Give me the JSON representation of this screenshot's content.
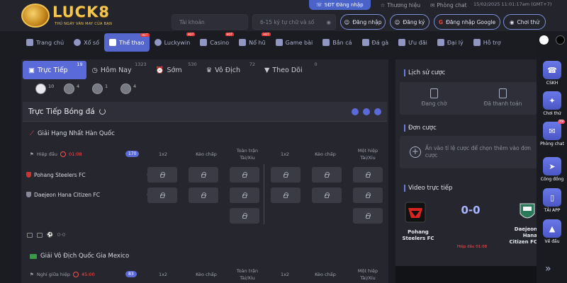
{
  "brand": {
    "name": "LUCK8",
    "tagline": "THỦ NGÀY VÀN MAY CỦA BẠN"
  },
  "topbar": {
    "phone_login": "SĐT Đăng nhập",
    "brand_link": "Thương hiệu",
    "chat_link": "Phòng chat",
    "datetime": "15/02/2025 11:01:17am (GMT+7)"
  },
  "login": {
    "username_placeholder": "Tài khoản",
    "password_placeholder": "6-15 ký tự chữ và số",
    "login_btn": "Đăng nhập",
    "register_btn": "Đăng ký",
    "google_btn": "Đăng nhập Google",
    "demo_btn": "Chơi thử"
  },
  "nav": [
    {
      "label": "Trang chủ",
      "hot": ""
    },
    {
      "label": "Xổ số",
      "hot": ""
    },
    {
      "label": "Thể thao",
      "hot": "HOT"
    },
    {
      "label": "Luckywin",
      "hot": "HOT"
    },
    {
      "label": "Casino",
      "hot": "HOT"
    },
    {
      "label": "Nổ hũ",
      "hot": "HOT"
    },
    {
      "label": "Game bài",
      "hot": ""
    },
    {
      "label": "Bắn cá",
      "hot": ""
    },
    {
      "label": "Đá gà",
      "hot": ""
    },
    {
      "label": "Ưu đãi",
      "hot": ""
    },
    {
      "label": "Đại lý",
      "hot": ""
    },
    {
      "label": "Hỗ trợ",
      "hot": ""
    }
  ],
  "tabs": [
    {
      "label": "Trực Tiếp",
      "count": "19"
    },
    {
      "label": "Hôm Nay",
      "count": "1323"
    },
    {
      "label": "Sớm",
      "count": "530"
    },
    {
      "label": "Vô Địch",
      "count": "72"
    },
    {
      "label": "Theo Dõi",
      "count": "0"
    }
  ],
  "sports": [
    {
      "name": "football",
      "count": "10"
    },
    {
      "name": "basketball",
      "count": "4"
    },
    {
      "name": "tennis",
      "count": "1"
    },
    {
      "name": "volleyball",
      "count": "4"
    }
  ],
  "live_title": "Trực Tiếp Bóng đá",
  "leagues": [
    {
      "name": "Giải Hạng Nhất Hàn Quốc",
      "status": "Hiệp đầu",
      "time": "01:08",
      "markets": "170",
      "teams": [
        {
          "name": "Pohang Steelers FC",
          "score": "0"
        },
        {
          "name": "Daejeon Hana Citizen FC",
          "score": "0"
        }
      ],
      "footer_score": "0-0"
    },
    {
      "name": "Giải Vô Địch Quốc Gia Mexico",
      "status": "Nghỉ giữa hiệp",
      "time": "45:00",
      "markets": "83"
    }
  ],
  "cols": {
    "c1": "1x2",
    "c2": "Kèo chấp",
    "c3a": "Toàn trận",
    "c3b": "Tài/Xỉu",
    "c4": "1x2",
    "c5": "Kèo chấp",
    "c6a": "Một hiệp",
    "c6b": "Tài/Xỉu"
  },
  "right": {
    "history_title": "Lịch sử cược",
    "pending": "Đang chờ",
    "paid": "Đã thanh toán",
    "slip_title": "Đơn cược",
    "slip_hint": "Ấn vào tỉ lệ cược để chọn thêm vào đơn cược",
    "video_title": "Video trực tiếp",
    "home": "Pohang Steelers FC",
    "away": "Daejeon Hana Citizen FC",
    "score": "0-0",
    "status": "Hiệp đầu",
    "time": "01:08"
  },
  "sidebar": [
    {
      "label": "CSKH",
      "badge": ""
    },
    {
      "label": "Chơi thử",
      "badge": ""
    },
    {
      "label": "Phòng chat",
      "badge": "79"
    },
    {
      "label": "Công đồng",
      "badge": ""
    },
    {
      "label": "TẢI APP",
      "badge": ""
    },
    {
      "label": "Về đầu",
      "badge": ""
    }
  ],
  "colors": {
    "accent": "#5a6ad8",
    "bg": "#1b1c22",
    "gold": "#f3c64d",
    "live": "#ff4d4d"
  },
  "icons": [
    "home-icon",
    "lottery-icon",
    "sports-icon",
    "casino-icon",
    "slot-icon",
    "cards-icon",
    "fish-icon",
    "rooster-icon",
    "gift-icon",
    "agent-icon",
    "help-icon"
  ]
}
